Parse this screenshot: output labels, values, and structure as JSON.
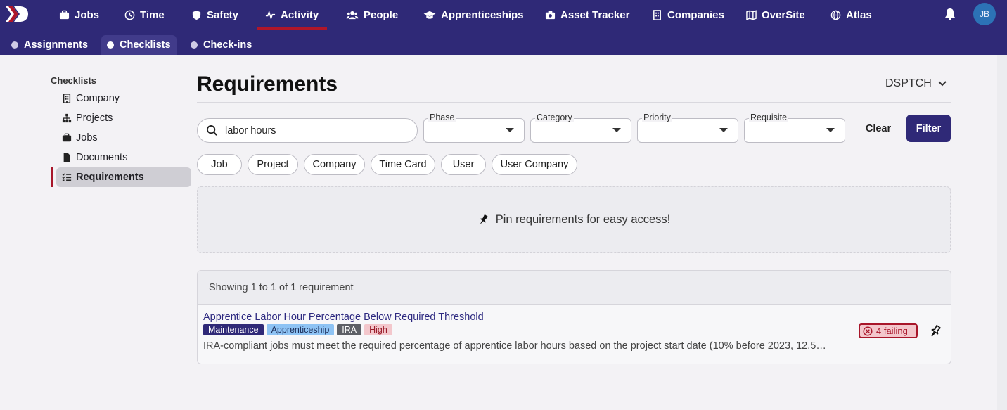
{
  "nav": {
    "items": [
      {
        "label": "Jobs",
        "icon": "briefcase-icon"
      },
      {
        "label": "Time",
        "icon": "clock-icon"
      },
      {
        "label": "Safety",
        "icon": "shield-icon"
      },
      {
        "label": "Activity",
        "icon": "activity-icon",
        "active": true
      },
      {
        "label": "People",
        "icon": "people-icon"
      },
      {
        "label": "Apprenticeships",
        "icon": "graduation-cap-icon"
      },
      {
        "label": "Asset Tracker",
        "icon": "camera-icon"
      },
      {
        "label": "Companies",
        "icon": "building-icon"
      },
      {
        "label": "OverSite",
        "icon": "map-icon"
      },
      {
        "label": "Atlas",
        "icon": "globe-icon"
      }
    ],
    "avatar_initials": "JB"
  },
  "subnav": {
    "items": [
      {
        "label": "Assignments"
      },
      {
        "label": "Checklists",
        "active": true
      },
      {
        "label": "Check-ins"
      }
    ]
  },
  "sidebar": {
    "title": "Checklists",
    "items": [
      {
        "label": "Company",
        "icon": "building-icon"
      },
      {
        "label": "Projects",
        "icon": "sitemap-icon"
      },
      {
        "label": "Jobs",
        "icon": "briefcase-icon"
      },
      {
        "label": "Documents",
        "icon": "document-icon"
      },
      {
        "label": "Requirements",
        "icon": "checklist-icon",
        "active": true
      }
    ]
  },
  "header": {
    "title": "Requirements",
    "org_select": "DSPTCH"
  },
  "filters": {
    "search_value": "labor hours",
    "phase_label": "Phase",
    "category_label": "Category",
    "priority_label": "Priority",
    "requisite_label": "Requisite",
    "clear_label": "Clear",
    "filter_label": "Filter"
  },
  "chips": [
    "Job",
    "Project",
    "Company",
    "Time Card",
    "User",
    "User Company"
  ],
  "pin_panel": {
    "text": "Pin requirements for easy access!"
  },
  "results": {
    "summary": "Showing 1 to 1 of 1 requirement",
    "rows": [
      {
        "title": "Apprentice Labor Hour Percentage Below Required Threshold",
        "tags": [
          "Maintenance",
          "Apprenticeship",
          "IRA",
          "High"
        ],
        "description": "IRA-compliant jobs must meet the required percentage of apprentice labor hours based on the project start date (10% before 2023, 12.5…",
        "status": "4 failing"
      }
    ]
  },
  "colors": {
    "brand": "#2f2977",
    "accent_red": "#a8162a",
    "background": "#f3f2f5"
  }
}
